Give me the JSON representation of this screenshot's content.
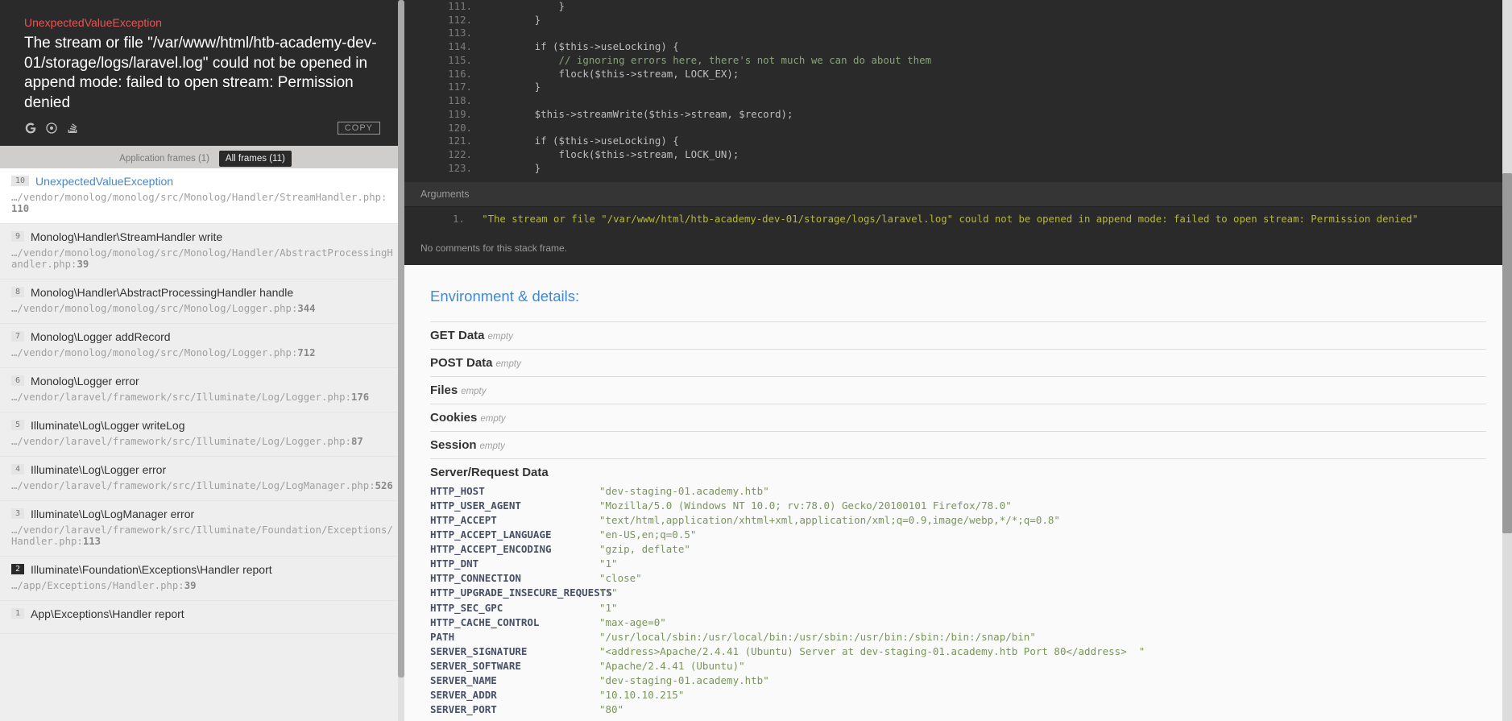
{
  "exception": {
    "name": "UnexpectedValueException",
    "message": "The stream or file \"/var/www/html/htb-academy-dev-01/storage/logs/laravel.log\" could not be opened in append mode: failed to open stream: Permission denied",
    "copy_label": "COPY"
  },
  "filters": {
    "app": "Application frames (1)",
    "all": "All frames (11)"
  },
  "frames": [
    {
      "num": "10",
      "dark": false,
      "active": true,
      "title": "UnexpectedValueException",
      "path": "…/vendor/monolog/monolog/src/Monolog/Handler/StreamHandler.php",
      "line": "110"
    },
    {
      "num": "9",
      "dark": false,
      "active": false,
      "title": "Monolog\\Handler\\StreamHandler write",
      "path": "…/vendor/monolog/monolog/src/Monolog/Handler/AbstractProcessingHandler.php",
      "line": "39"
    },
    {
      "num": "8",
      "dark": false,
      "active": false,
      "title": "Monolog\\Handler\\AbstractProcessingHandler handle",
      "path": "…/vendor/monolog/monolog/src/Monolog/Logger.php",
      "line": "344"
    },
    {
      "num": "7",
      "dark": false,
      "active": false,
      "title": "Monolog\\Logger addRecord",
      "path": "…/vendor/monolog/monolog/src/Monolog/Logger.php",
      "line": "712"
    },
    {
      "num": "6",
      "dark": false,
      "active": false,
      "title": "Monolog\\Logger error",
      "path": "…/vendor/laravel/framework/src/Illuminate/Log/Logger.php",
      "line": "176"
    },
    {
      "num": "5",
      "dark": false,
      "active": false,
      "title": "Illuminate\\Log\\Logger writeLog",
      "path": "…/vendor/laravel/framework/src/Illuminate/Log/Logger.php",
      "line": "87"
    },
    {
      "num": "4",
      "dark": false,
      "active": false,
      "title": "Illuminate\\Log\\Logger error",
      "path": "…/vendor/laravel/framework/src/Illuminate/Log/LogManager.php",
      "line": "526"
    },
    {
      "num": "3",
      "dark": false,
      "active": false,
      "title": "Illuminate\\Log\\LogManager error",
      "path": "…/vendor/laravel/framework/src/Illuminate/Foundation/Exceptions/Handler.php",
      "line": "113"
    },
    {
      "num": "2",
      "dark": true,
      "active": false,
      "title": "Illuminate\\Foundation\\Exceptions\\Handler report",
      "path": "…/app/Exceptions/Handler.php",
      "line": "39"
    },
    {
      "num": "1",
      "dark": false,
      "active": false,
      "title": "App\\Exceptions\\Handler report",
      "path": "",
      "line": ""
    }
  ],
  "code": [
    {
      "n": "111",
      "text": "            }"
    },
    {
      "n": "112",
      "text": "        }"
    },
    {
      "n": "113",
      "text": ""
    },
    {
      "n": "114",
      "text": "        if ($this->useLocking) {"
    },
    {
      "n": "115",
      "text": "            // ignoring errors here, there's not much we can do about them"
    },
    {
      "n": "116",
      "text": "            flock($this->stream, LOCK_EX);"
    },
    {
      "n": "117",
      "text": "        }"
    },
    {
      "n": "118",
      "text": ""
    },
    {
      "n": "119",
      "text": "        $this->streamWrite($this->stream, $record);"
    },
    {
      "n": "120",
      "text": ""
    },
    {
      "n": "121",
      "text": "        if ($this->useLocking) {"
    },
    {
      "n": "122",
      "text": "            flock($this->stream, LOCK_UN);"
    },
    {
      "n": "123",
      "text": "        }"
    }
  ],
  "arguments_label": "Arguments",
  "argument_value": "\"The stream or file \"/var/www/html/htb-academy-dev-01/storage/logs/laravel.log\" could not be opened in append mode: failed to open stream: Permission denied\"",
  "no_comments": "No comments for this stack frame.",
  "details": {
    "heading": "Environment & details:",
    "sections": [
      {
        "label": "GET Data",
        "empty": "empty"
      },
      {
        "label": "POST Data",
        "empty": "empty"
      },
      {
        "label": "Files",
        "empty": "empty"
      },
      {
        "label": "Cookies",
        "empty": "empty"
      },
      {
        "label": "Session",
        "empty": "empty"
      }
    ],
    "server_label": "Server/Request Data",
    "server": [
      [
        "HTTP_HOST",
        "\"dev-staging-01.academy.htb\""
      ],
      [
        "HTTP_USER_AGENT",
        "\"Mozilla/5.0 (Windows NT 10.0; rv:78.0) Gecko/20100101 Firefox/78.0\""
      ],
      [
        "HTTP_ACCEPT",
        "\"text/html,application/xhtml+xml,application/xml;q=0.9,image/webp,*/*;q=0.8\""
      ],
      [
        "HTTP_ACCEPT_LANGUAGE",
        "\"en-US,en;q=0.5\""
      ],
      [
        "HTTP_ACCEPT_ENCODING",
        "\"gzip, deflate\""
      ],
      [
        "HTTP_DNT",
        "\"1\""
      ],
      [
        "HTTP_CONNECTION",
        "\"close\""
      ],
      [
        "HTTP_UPGRADE_INSECURE_REQUESTS",
        "\"1\""
      ],
      [
        "HTTP_SEC_GPC",
        "\"1\""
      ],
      [
        "HTTP_CACHE_CONTROL",
        "\"max-age=0\""
      ],
      [
        "PATH",
        "\"/usr/local/sbin:/usr/local/bin:/usr/sbin:/usr/bin:/sbin:/bin:/snap/bin\""
      ],
      [
        "SERVER_SIGNATURE",
        "\"<address>Apache/2.4.41 (Ubuntu) Server at dev-staging-01.academy.htb Port 80</address>  \""
      ],
      [
        "SERVER_SOFTWARE",
        "\"Apache/2.4.41 (Ubuntu)\""
      ],
      [
        "SERVER_NAME",
        "\"dev-staging-01.academy.htb\""
      ],
      [
        "SERVER_ADDR",
        "\"10.10.10.215\""
      ],
      [
        "SERVER_PORT",
        "\"80\""
      ]
    ]
  }
}
